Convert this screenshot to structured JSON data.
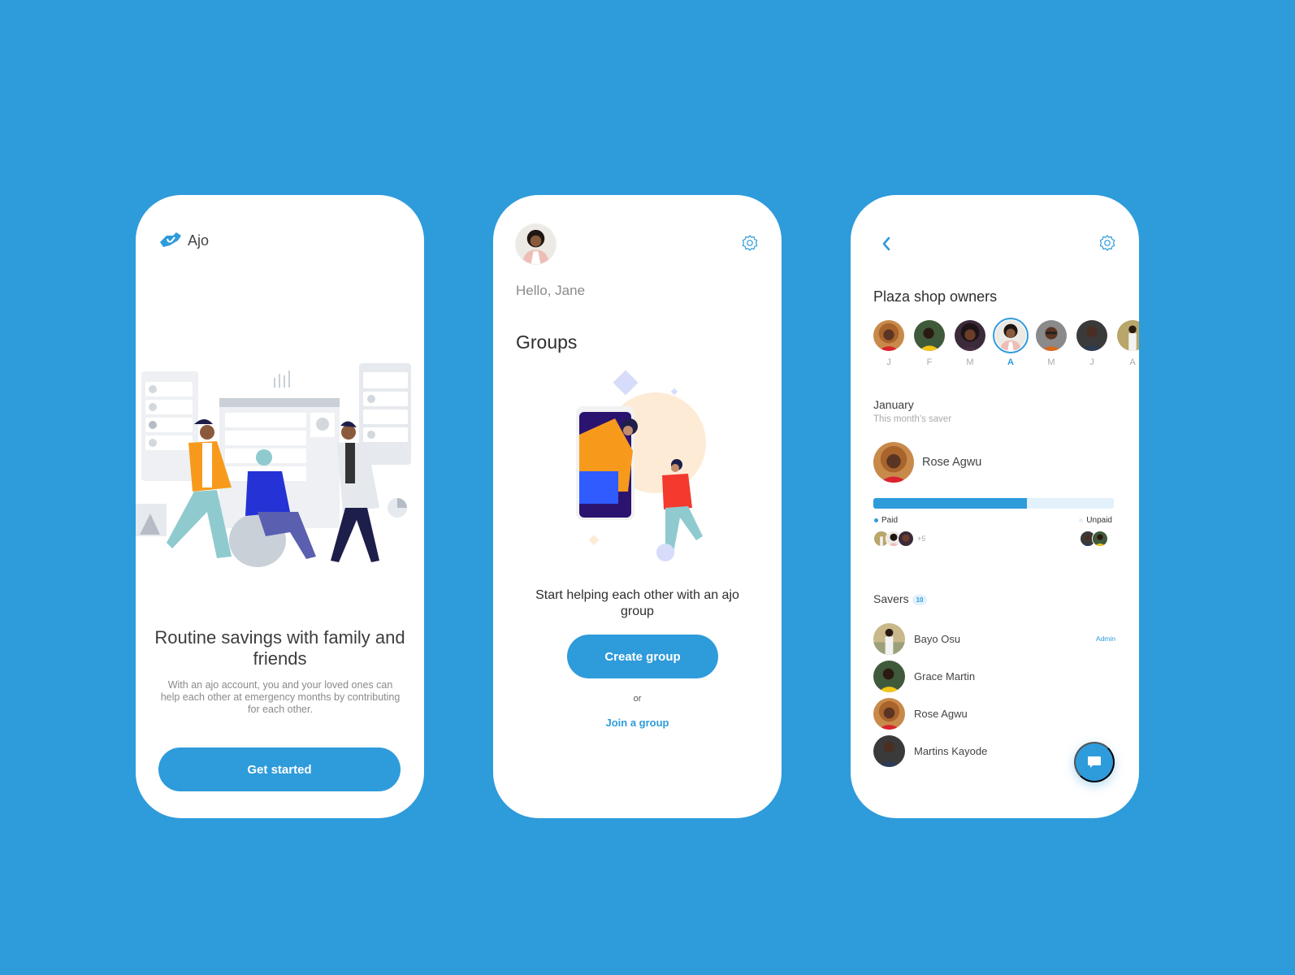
{
  "colors": {
    "background": "#2E9BDB",
    "accent": "#2E9BDB",
    "track": "#E2F1FC"
  },
  "onboarding": {
    "app_name": "Ajo",
    "logo_icon": "handshake-icon",
    "illustration": "team-collaboration-illustration",
    "headline": "Routine savings with family and friends",
    "description": "With an ajo account, you and your loved ones can help each other at emergency months by contributing for each other.",
    "cta_label": "Get started"
  },
  "groups_screen": {
    "greeting": "Hello, Jane",
    "settings_icon": "gear-icon",
    "title": "Groups",
    "illustration": "helping-hand-phone-illustration",
    "empty_message": "Start helping each other with an ajo group",
    "create_label": "Create group",
    "or_label": "or",
    "join_label": "Join a group"
  },
  "group_detail": {
    "back_icon": "chevron-left-icon",
    "settings_icon": "gear-icon",
    "title": "Plaza shop owners",
    "months": [
      {
        "label": "J",
        "active": false
      },
      {
        "label": "F",
        "active": false
      },
      {
        "label": "M",
        "active": false
      },
      {
        "label": "A",
        "active": true
      },
      {
        "label": "M",
        "active": false
      },
      {
        "label": "J",
        "active": false
      },
      {
        "label": "A",
        "active": false
      }
    ],
    "current_month": "January",
    "saver_caption": "This month's saver",
    "saver_name": "Rose Agwu",
    "paid_fraction": 0.64,
    "paid_label": "Paid",
    "unpaid_label": "Unpaid",
    "paid_extra_count": "+5",
    "savers_label": "Savers",
    "savers_count": "10",
    "savers": [
      {
        "name": "Bayo Osu",
        "role": "Admin"
      },
      {
        "name": "Grace Martin",
        "role": ""
      },
      {
        "name": "Rose Agwu",
        "role": ""
      },
      {
        "name": "Martins Kayode",
        "role": ""
      }
    ],
    "fab_icon": "chat-icon"
  }
}
